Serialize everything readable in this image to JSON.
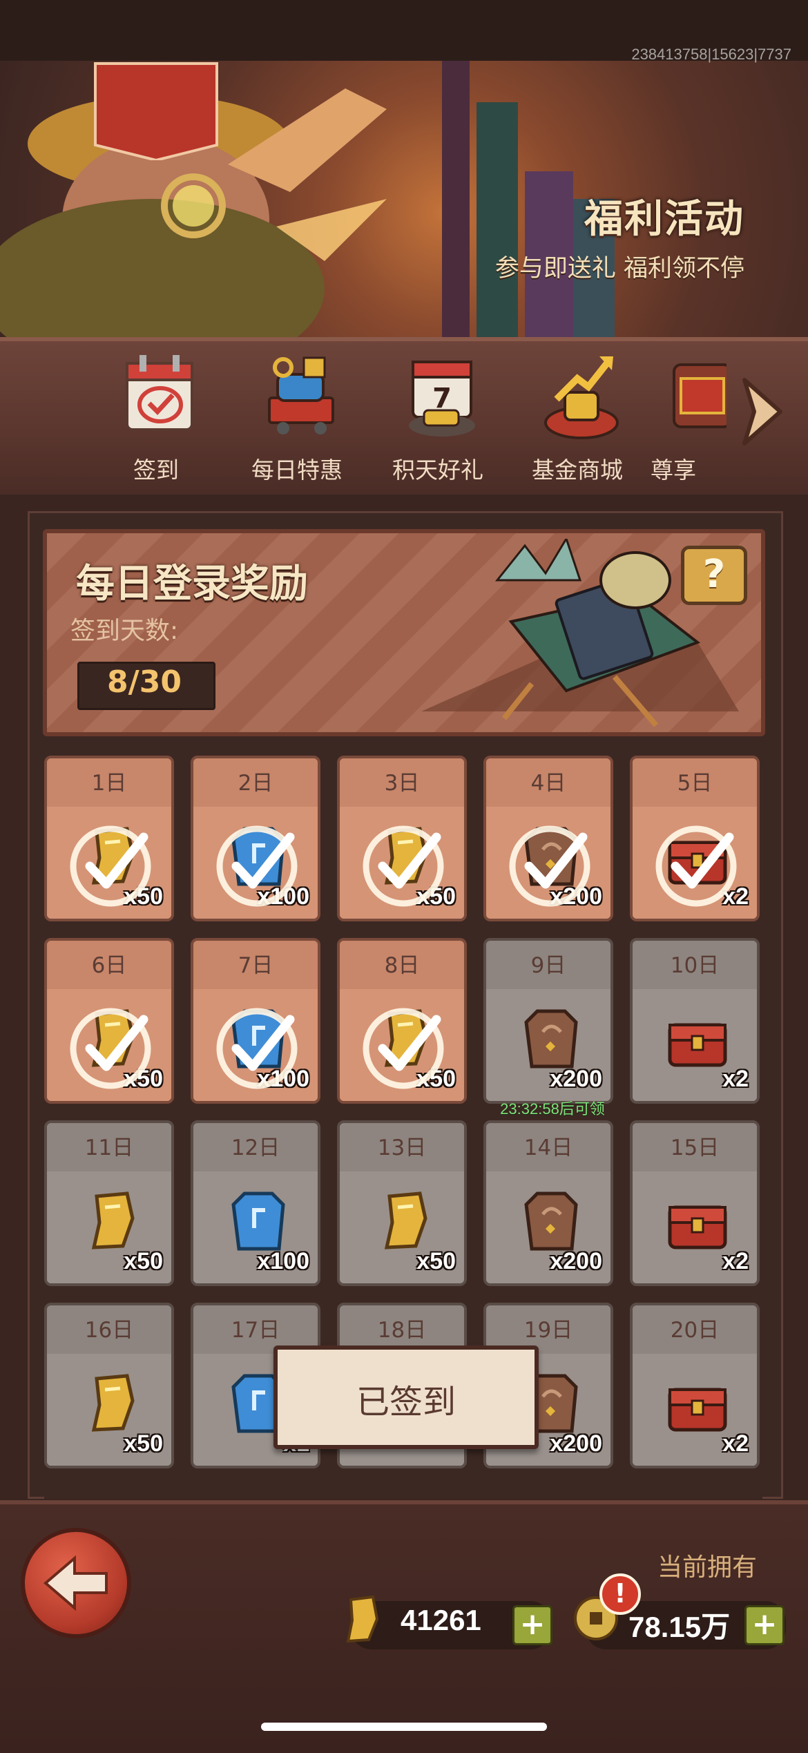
{
  "status": {
    "uid": "238413758|15623|7737"
  },
  "banner": {
    "title": "福利活动",
    "subtitle": "参与即送礼 福利领不停"
  },
  "tabs": [
    {
      "label": "签到",
      "icon": "calendar-check-icon",
      "active": true
    },
    {
      "label": "每日特惠",
      "icon": "treasure-cart-icon",
      "active": false
    },
    {
      "label": "积天好礼",
      "icon": "calendar-gold-icon",
      "active": false
    },
    {
      "label": "基金商城",
      "icon": "fund-growth-icon",
      "active": false
    },
    {
      "label": "尊享",
      "icon": "vip-gift-icon",
      "active": false
    }
  ],
  "login": {
    "title": "每日登录奖励",
    "days_label": "签到天数:",
    "days_value": "8/30"
  },
  "help": {
    "label": "?"
  },
  "rewards": [
    {
      "day": "1日",
      "qty": "x50",
      "item": "gold-ingot",
      "claimed": true
    },
    {
      "day": "2日",
      "qty": "x100",
      "item": "blue-stone",
      "claimed": true
    },
    {
      "day": "3日",
      "qty": "x50",
      "item": "gold-ingot",
      "claimed": true
    },
    {
      "day": "4日",
      "qty": "x200",
      "item": "bronze-stone",
      "claimed": true
    },
    {
      "day": "5日",
      "qty": "x2",
      "item": "red-chest",
      "claimed": true
    },
    {
      "day": "6日",
      "qty": "x50",
      "item": "gold-ingot",
      "claimed": true
    },
    {
      "day": "7日",
      "qty": "x100",
      "item": "blue-stone",
      "claimed": true
    },
    {
      "day": "8日",
      "qty": "x50",
      "item": "gold-ingot",
      "claimed": true
    },
    {
      "day": "9日",
      "qty": "x200",
      "item": "bronze-stone",
      "claimed": false
    },
    {
      "day": "10日",
      "qty": "x2",
      "item": "red-chest",
      "claimed": false
    },
    {
      "day": "11日",
      "qty": "x50",
      "item": "gold-ingot",
      "claimed": false
    },
    {
      "day": "12日",
      "qty": "x100",
      "item": "blue-stone",
      "claimed": false
    },
    {
      "day": "13日",
      "qty": "x50",
      "item": "gold-ingot",
      "claimed": false
    },
    {
      "day": "14日",
      "qty": "x200",
      "item": "bronze-stone",
      "claimed": false
    },
    {
      "day": "15日",
      "qty": "x2",
      "item": "red-chest",
      "claimed": false
    },
    {
      "day": "16日",
      "qty": "x50",
      "item": "gold-ingot",
      "claimed": false
    },
    {
      "day": "17日",
      "qty": "x1",
      "item": "blue-stone",
      "claimed": false
    },
    {
      "day": "18日",
      "qty": "",
      "item": "gold-ingot",
      "claimed": false
    },
    {
      "day": "19日",
      "qty": "x200",
      "item": "bronze-stone",
      "claimed": false
    },
    {
      "day": "20日",
      "qty": "x2",
      "item": "red-chest",
      "claimed": false
    }
  ],
  "timer": "23:32:58后可领",
  "toast": "已签到",
  "bottom": {
    "owned_label": "当前拥有",
    "gold_value": "41261",
    "coin_value": "78.15万",
    "alert": "!"
  },
  "colors": {
    "claimed": "#c98a6e",
    "locked": "#8a807b",
    "accent": "#f4c36e"
  }
}
